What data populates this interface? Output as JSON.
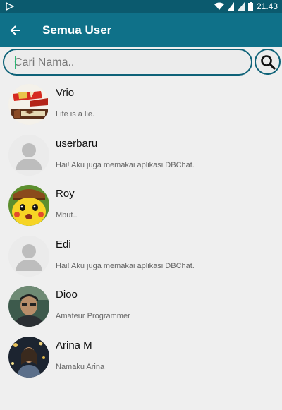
{
  "status_bar": {
    "time": "21.43",
    "icons": [
      "play-store-icon",
      "wifi-icon",
      "no-sim-icon",
      "cell-signal-icon",
      "battery-icon"
    ]
  },
  "app_bar": {
    "title": "Semua User",
    "back_icon": "arrow-left-icon"
  },
  "search": {
    "placeholder": "Cari Nama..",
    "value": "",
    "button_icon": "search-icon"
  },
  "colors": {
    "primary": "#0f7189",
    "primary_dark": "#0b5a6e",
    "background": "#efefef"
  },
  "users": [
    {
      "name": "Vrio",
      "status": "Life is a lie.",
      "avatar": "chocolate-bar-photo"
    },
    {
      "name": "userbaru",
      "status": "Hai! Aku juga memakai aplikasi DBChat.",
      "avatar": "default-user-silhouette"
    },
    {
      "name": "Roy",
      "status": "Mbut..",
      "avatar": "pikachu-photo"
    },
    {
      "name": "Edi",
      "status": "Hai! Aku juga memakai aplikasi DBChat.",
      "avatar": "default-user-silhouette"
    },
    {
      "name": "Dioo",
      "status": "Amateur Programmer",
      "avatar": "person-portrait-photo"
    },
    {
      "name": "Arina M",
      "status": "Namaku Arina",
      "avatar": "sparkle-portrait-photo"
    }
  ]
}
